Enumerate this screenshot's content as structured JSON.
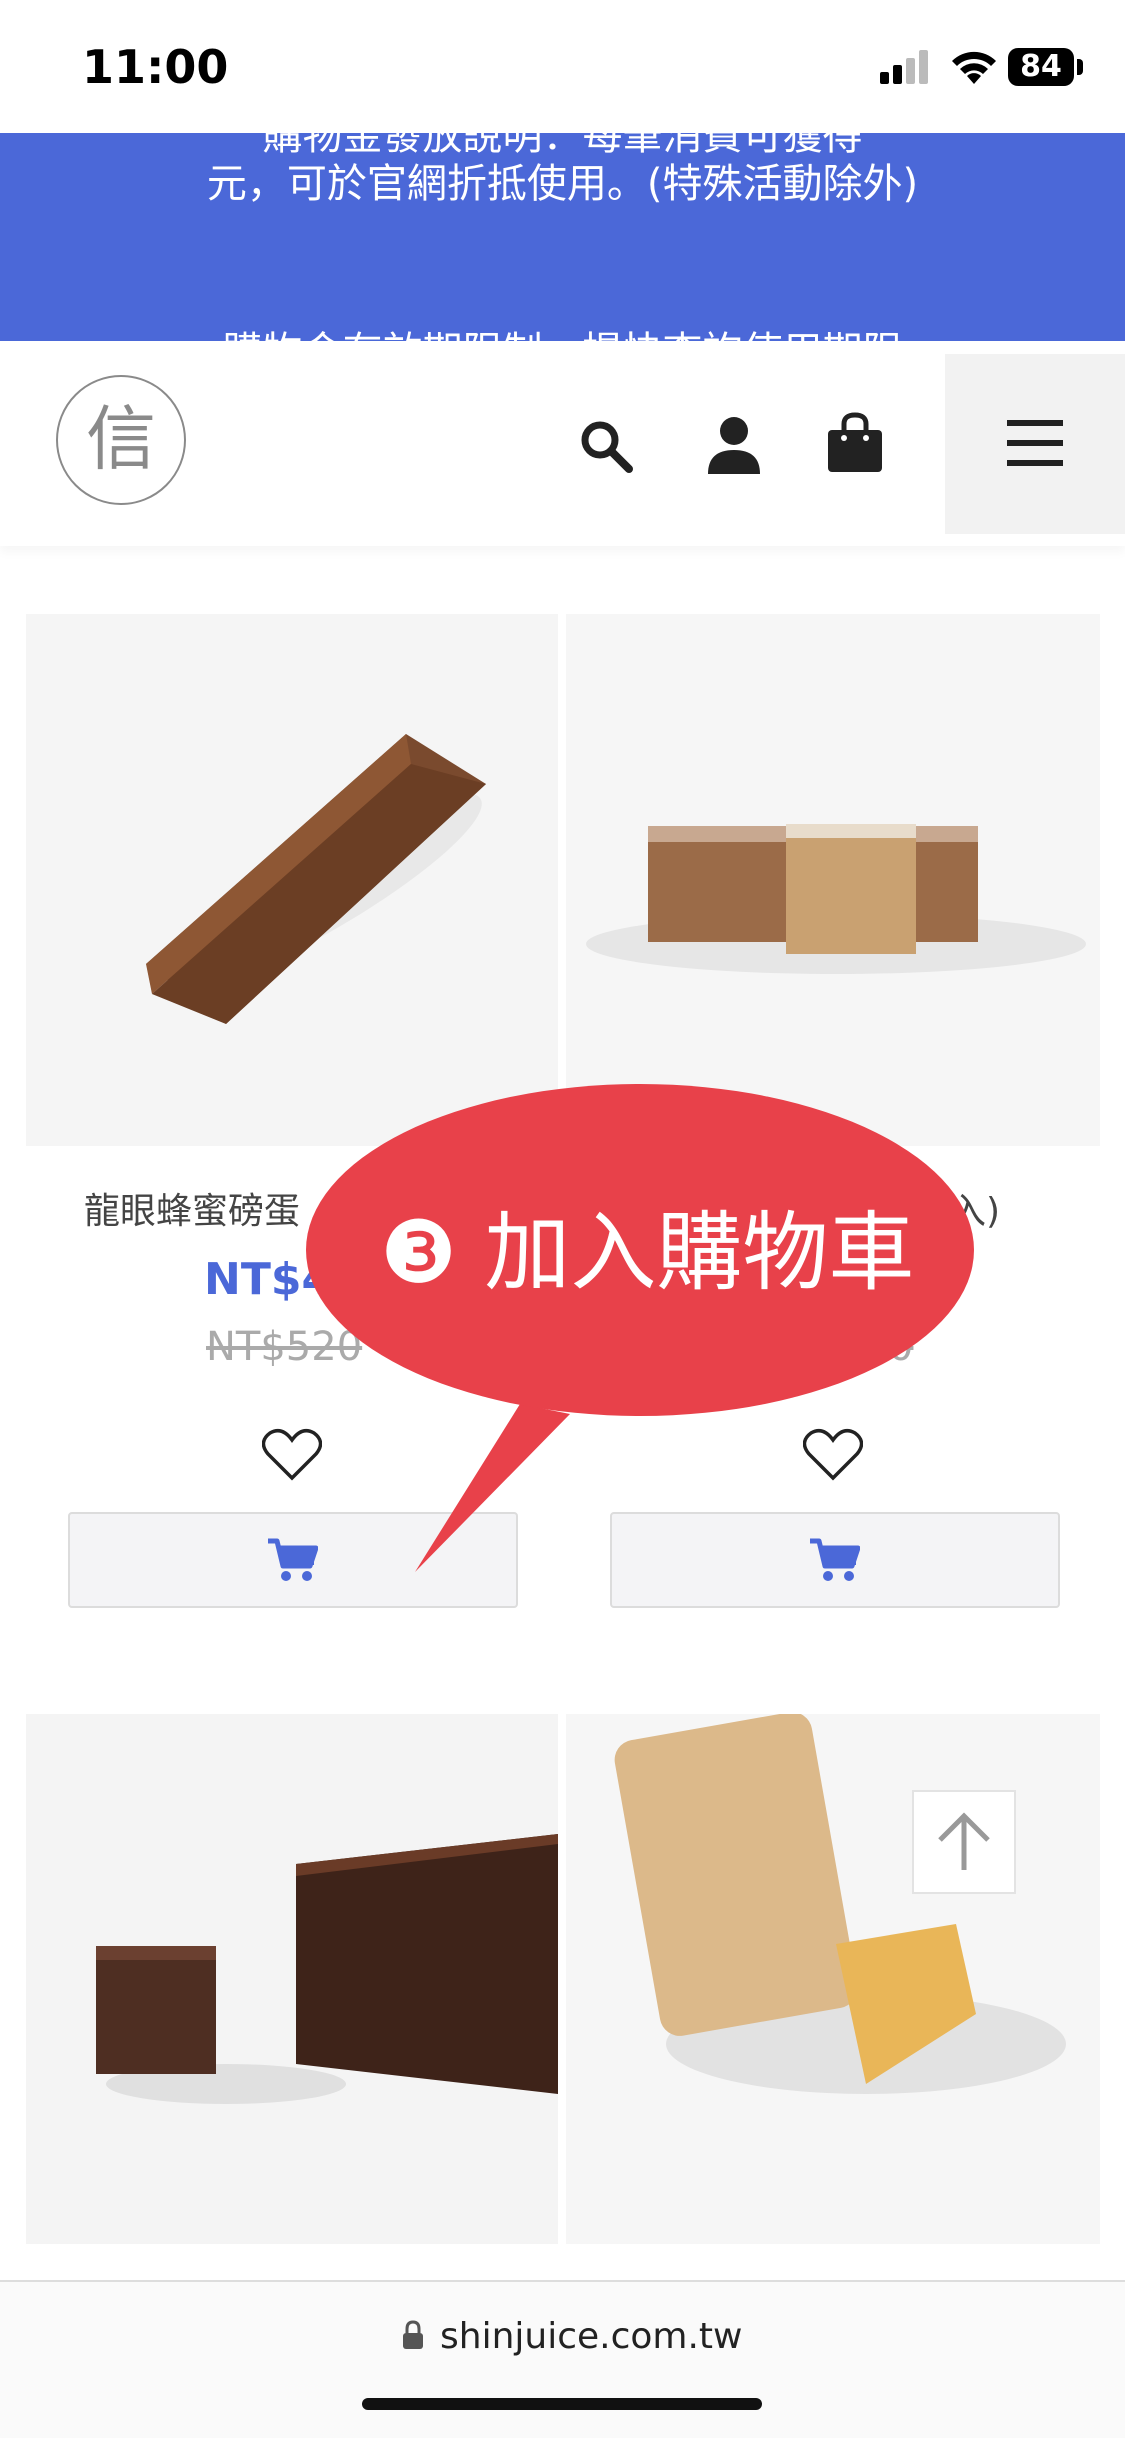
{
  "status": {
    "time": "11:00",
    "battery": "84"
  },
  "promo": {
    "line0": "購物金發放說明：每筆消費可獲得",
    "line1": "元，可於官網折抵使用。(特殊活動除外)",
    "line2": "購物金有效期限制，提快查詢使用期限"
  },
  "header": {
    "logo_char": "信"
  },
  "products": [
    {
      "name": "龍眼蜂蜜磅蛋",
      "price": "NT$4",
      "old_price": "NT$520"
    },
    {
      "name": "入)",
      "price": "",
      "old_price": "0"
    },
    {
      "name": "",
      "price": "",
      "old_price": ""
    },
    {
      "name": "",
      "price": "",
      "old_price": ""
    }
  ],
  "callout": {
    "text": "❸ 加入購物車",
    "color": "#e8414a"
  },
  "browser": {
    "url": "shinjuice.com.tw"
  },
  "colors": {
    "accent": "#4b68d8",
    "banner": "#4b68d8"
  }
}
